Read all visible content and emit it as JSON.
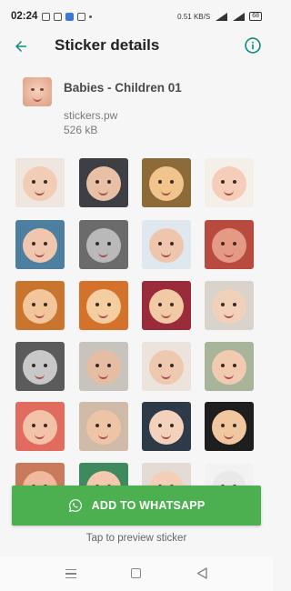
{
  "status_bar": {
    "time": "02:24",
    "net_speed": "0.51",
    "net_unit": "KB/S",
    "battery": "68"
  },
  "appbar": {
    "title": "Sticker details",
    "back_icon": "arrow-back-icon",
    "info_icon": "info-icon"
  },
  "pack": {
    "name": "Babies - Children 01",
    "publisher": "stickers.pw",
    "size": "526 kB"
  },
  "stickers": [
    {
      "bg": "#efe6e0",
      "face": "#f1cdb6"
    },
    {
      "bg": "#3d3f45",
      "face": "#e8c0a6"
    },
    {
      "bg": "#8c6a3a",
      "face": "#f0c48a"
    },
    {
      "bg": "#f4efe9",
      "face": "#f5cdb9"
    },
    {
      "bg": "#4d7fa1",
      "face": "#f0c7ae"
    },
    {
      "bg": "#6b6b6b",
      "face": "#b9b9b9"
    },
    {
      "bg": "#dfe8ee",
      "face": "#edc6ad"
    },
    {
      "bg": "#b94b3e",
      "face": "#e59a86"
    },
    {
      "bg": "#c9752d",
      "face": "#f3c59a"
    },
    {
      "bg": "#d4722c",
      "face": "#f4cda0"
    },
    {
      "bg": "#9a2b3b",
      "face": "#f1c9a5"
    },
    {
      "bg": "#d9d3cc",
      "face": "#f2d1bb"
    },
    {
      "bg": "#5b5b5b",
      "face": "#c8c8c8"
    },
    {
      "bg": "#c9c3bd",
      "face": "#e4bda2"
    },
    {
      "bg": "#ece4dc",
      "face": "#efc9af"
    },
    {
      "bg": "#a9b59a",
      "face": "#f1cab0"
    },
    {
      "bg": "#e06b5e",
      "face": "#f2c3a8"
    },
    {
      "bg": "#cfbba8",
      "face": "#eec4a7"
    },
    {
      "bg": "#2f3a48",
      "face": "#f3d2bd"
    },
    {
      "bg": "#1e1e1e",
      "face": "#f1c7a0"
    },
    {
      "bg": "#c97a5a",
      "face": "#f0b89c"
    },
    {
      "bg": "#3e8a5e",
      "face": "#f2c9ae"
    },
    {
      "bg": "#e3dbd4",
      "face": "#f3cfb8"
    },
    {
      "bg": "#f2f2f2",
      "face": "#e9e9e9"
    }
  ],
  "action": {
    "add_label": "ADD TO WHATSAPP",
    "add_icon": "whatsapp-icon",
    "hint": "Tap to preview sticker"
  },
  "colors": {
    "accent": "#128c7e",
    "button": "#4caf50"
  }
}
